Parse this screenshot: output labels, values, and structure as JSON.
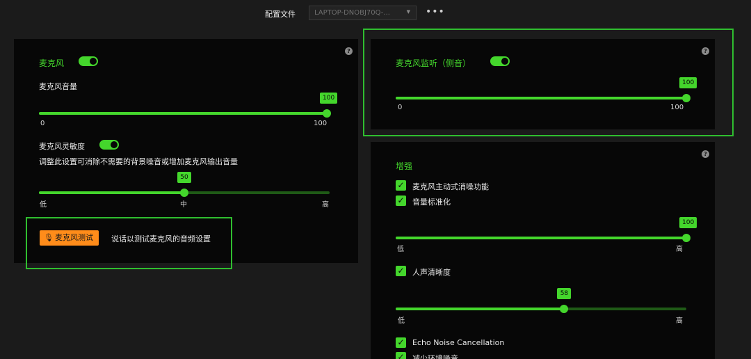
{
  "header": {
    "profile_label": "配置文件",
    "profile_value": "LAPTOP-DNOBJ70Q-...",
    "more_label": "•••"
  },
  "icons": {
    "help": "help-icon",
    "more": "more-icon",
    "caret": "chevron-down-icon",
    "mic": "microphone-icon",
    "check": "checkmark-icon"
  },
  "colors": {
    "accent": "#44d62c",
    "test_button": "#ff8c1a",
    "highlight": "#2fbe2f"
  },
  "mic_panel": {
    "title": "麦克风",
    "enabled": true,
    "volume": {
      "label": "麦克风音量",
      "value": 100,
      "value_label": "100",
      "min_label": "0",
      "max_label": "100"
    },
    "sensitivity": {
      "label": "麦克风灵敏度",
      "enabled": true,
      "description": "调整此设置可消除不需要的背景噪音或增加麦克风输出音量",
      "value": 50,
      "value_label": "50",
      "low_label": "低",
      "mid_label": "中",
      "high_label": "高"
    },
    "test": {
      "button_label": "麦克风测试",
      "description": "说话以测试麦克风的音频设置"
    }
  },
  "monitor_panel": {
    "title": "麦克风监听（侧音）",
    "enabled": true,
    "value": 100,
    "value_label": "100",
    "min_label": "0",
    "max_label": "100"
  },
  "enhance_panel": {
    "title": "增强",
    "options": [
      {
        "label": "麦克风主动式消噪功能",
        "checked": true
      },
      {
        "label": "音量标准化",
        "checked": true
      }
    ],
    "normalization": {
      "value": 100,
      "value_label": "100",
      "low_label": "低",
      "high_label": "高"
    },
    "clarity": {
      "label": "人声清晰度",
      "checked": true,
      "value": 58,
      "value_label": "58",
      "low_label": "低",
      "high_label": "高"
    },
    "echo": {
      "label": "Echo Noise Cancellation",
      "checked": true
    },
    "ambient": {
      "label": "减少环境噪音",
      "checked": true
    }
  }
}
